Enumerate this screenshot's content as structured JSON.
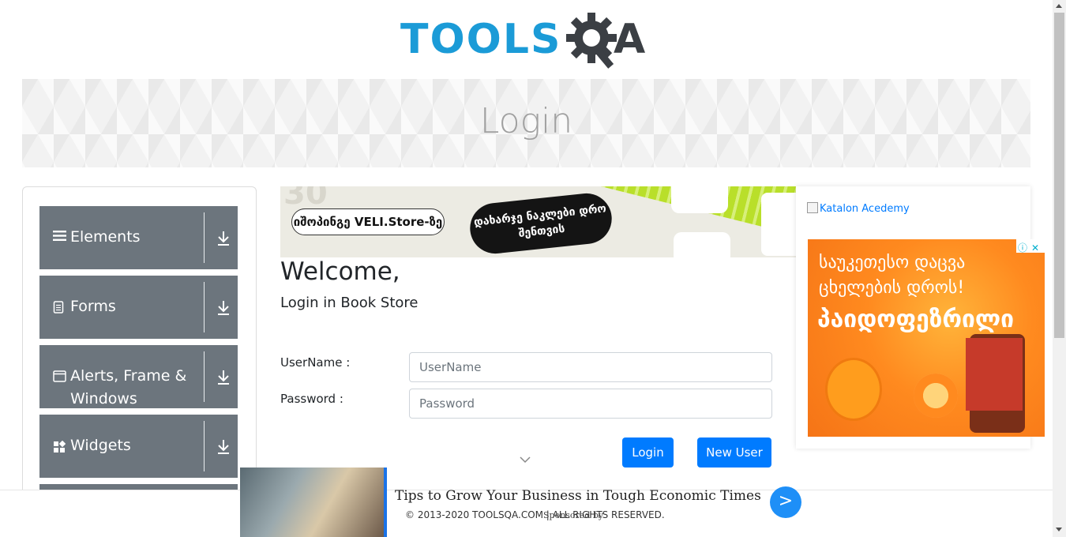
{
  "header": {
    "logo_text_main": "TOOLS",
    "logo_text_a": "A"
  },
  "banner": {
    "title": "Login"
  },
  "sidebar": {
    "groups": [
      {
        "label": "Elements",
        "icon": "menu-icon"
      },
      {
        "label": "Forms",
        "icon": "document-icon"
      },
      {
        "label": "Alerts, Frame & Windows",
        "icon": "window-icon"
      },
      {
        "label": "Widgets",
        "icon": "widgets-icon"
      }
    ]
  },
  "top_ad": {
    "pill_text": "იშოპინგე VELI.Store-ზე",
    "blob_text": "დახარჯე ნაკლები დრო შენთვის",
    "big_number": "30"
  },
  "login": {
    "welcome": "Welcome,",
    "subtitle": "Login in Book Store",
    "username_label": "UserName :",
    "password_label": "Password :",
    "username_placeholder": "UserName",
    "password_placeholder": "Password",
    "login_button": "Login",
    "new_user_button": "New User"
  },
  "right_ad": {
    "katalon_alt": "Katalon Acedemy",
    "line1": "საუკეთესო დაცვა",
    "line2": "ცხელების დროს!",
    "brand": "პაიდოფეზრილი",
    "badge_info": "ⓘ",
    "badge_close": "✕"
  },
  "bottom_ad": {
    "headline": "Tips to Grow Your Business in Tough Economic Times",
    "sponsor": "Sponsored by",
    "go_symbol": ">"
  },
  "footer": {
    "copyright": "© 2013-2020 TOOLSQA.COM | ALL RIGHTS RESERVED."
  },
  "colors": {
    "primary": "#007bff",
    "sidebar_group": "#6c757d",
    "logo_blue": "#1b9bd7",
    "logo_dark": "#3b3f44"
  }
}
